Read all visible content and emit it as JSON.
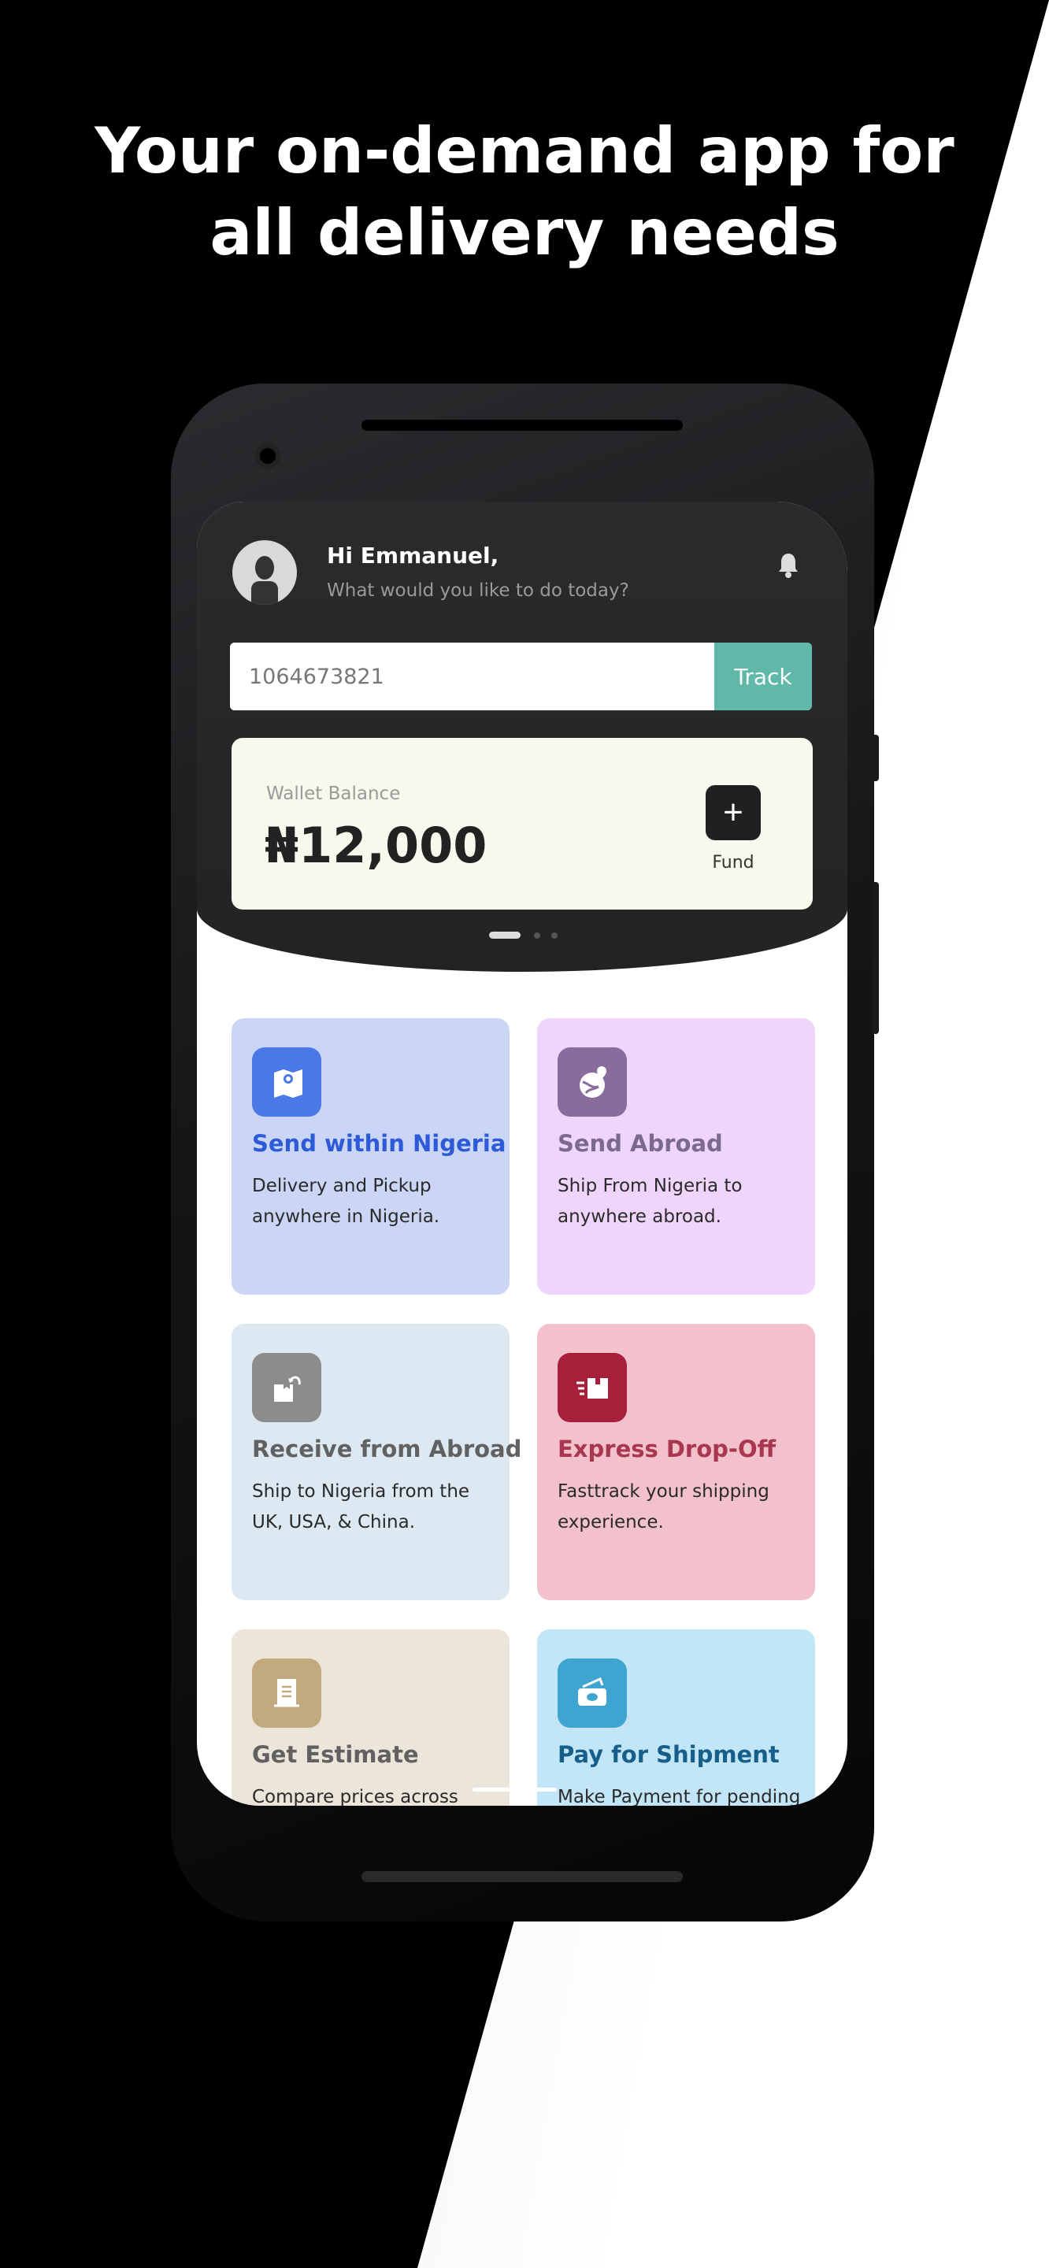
{
  "headline": [
    "Your on-demand app for",
    "all delivery needs"
  ],
  "header": {
    "greeting": "Hi Emmanuel,",
    "subtitle": "What would you like to do today?"
  },
  "track": {
    "value": "1064673821",
    "button": "Track"
  },
  "wallet": {
    "label": "Wallet Balance",
    "amount": "₦12,000",
    "fund_label": "Fund",
    "fund_icon": "+"
  },
  "carousel": {
    "pages": 3,
    "active": 1
  },
  "colors": {
    "track": "#5fb8a8",
    "wallet_bg": "#f8f8ec"
  },
  "services": [
    {
      "title": "Send within Nigeria",
      "desc": "Delivery and Pickup anywhere in Nigeria.",
      "icon": "map-pin-icon",
      "bg": "#cbd5f5",
      "color": "#2d5bd8",
      "icon_bg": "#4a78e6"
    },
    {
      "title": "Send Abroad",
      "desc": "Ship From Nigeria to anywhere abroad.",
      "icon": "globe-pin-icon",
      "bg": "#efd5fb",
      "color": "#7a6a8e",
      "icon_bg": "#8a6c9c"
    },
    {
      "title": "Receive from Abroad",
      "desc": "Ship to Nigeria from the UK, USA, & China.",
      "icon": "box-return-icon",
      "bg": "#dde9f2",
      "color": "#616161",
      "icon_bg": "#8c8c8c"
    },
    {
      "title": "Express Drop-Off",
      "desc": "Fasttrack your shipping experience.",
      "icon": "fast-box-icon",
      "bg": "#f2c1cc",
      "color": "#a8374f",
      "icon_bg": "#a81f3c"
    },
    {
      "title": "Get Estimate",
      "desc": "Compare prices across",
      "icon": "receipt-icon",
      "bg": "#ebe5da",
      "color": "#616161",
      "icon_bg": "#c2a97e"
    },
    {
      "title": "Pay for Shipment",
      "desc": "Make Payment for pending",
      "icon": "cash-icon",
      "bg": "#c2e6f7",
      "color": "#155f8a",
      "icon_bg": "#3fa5d0"
    }
  ]
}
